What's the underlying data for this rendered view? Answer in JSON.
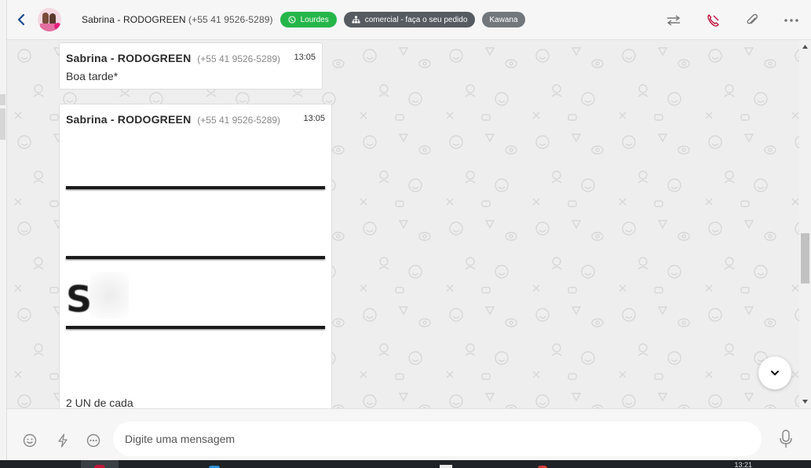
{
  "header": {
    "contact_name": "Sabrina - RODOGREEN",
    "contact_phone": "(+55 41 9526-5289)",
    "tags": [
      {
        "label": "Lourdes",
        "color": "#25b64a",
        "icon": "whatsapp-icon"
      },
      {
        "label": "comercial - faça o seu pedido",
        "color": "#555b60",
        "icon": "sitemap-icon"
      },
      {
        "label": "Kawana",
        "color": "#72777c"
      }
    ],
    "actions": [
      "transfer-icon",
      "end-call-icon",
      "attach-icon",
      "more-icon"
    ]
  },
  "messages": [
    {
      "sender": "Sabrina - RODOGREEN",
      "phone": "(+55 41 9526-5289)",
      "time": "13:05",
      "text": "Boa tarde*"
    },
    {
      "sender": "Sabrina - RODOGREEN",
      "phone": "(+55 41 9526-5289)",
      "time": "13:05",
      "image_text": "S",
      "text": "2 UN de cada"
    }
  ],
  "composer": {
    "placeholder": "Digite uma mensagem",
    "buttons": [
      "emoji-icon",
      "lightning-icon",
      "quick-reply-icon",
      "microphone-icon"
    ]
  },
  "taskbar": {
    "time": "13:21"
  },
  "colors": {
    "accent_green": "#25b64a",
    "end_call_red": "#c0163c",
    "chat_background": "#eeeeee"
  }
}
